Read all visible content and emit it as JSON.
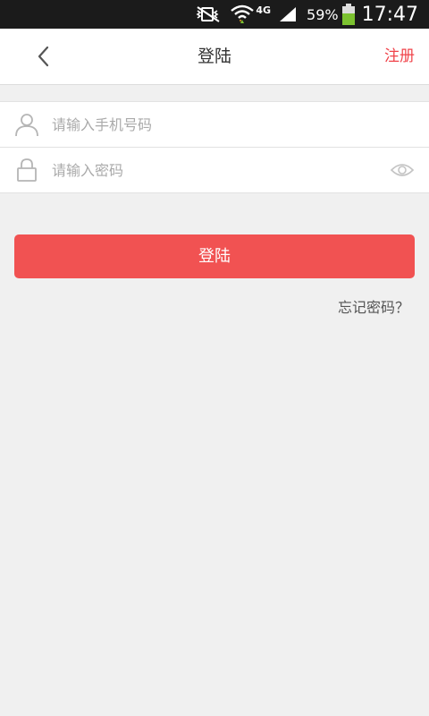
{
  "status_bar": {
    "network": "4G",
    "battery_percent": "59%",
    "time": "17:47",
    "icons": [
      "vibrate-off-icon",
      "wifi-icon",
      "signal-icon",
      "battery-icon"
    ]
  },
  "header": {
    "title": "登陆",
    "back_icon": "chevron-left-icon",
    "register_label": "注册"
  },
  "form": {
    "phone": {
      "placeholder": "请输入手机号码",
      "value": "",
      "icon": "user-icon"
    },
    "password": {
      "placeholder": "请输入密码",
      "value": "",
      "icon": "lock-icon",
      "toggle_icon": "eye-icon"
    }
  },
  "actions": {
    "login_label": "登陆",
    "forgot_label": "忘记密码？"
  },
  "colors": {
    "accent": "#f15252",
    "register_text": "#f0434a",
    "background": "#f0f0f0",
    "status_bar": "#1b1b1b",
    "battery": "#7cc230"
  }
}
